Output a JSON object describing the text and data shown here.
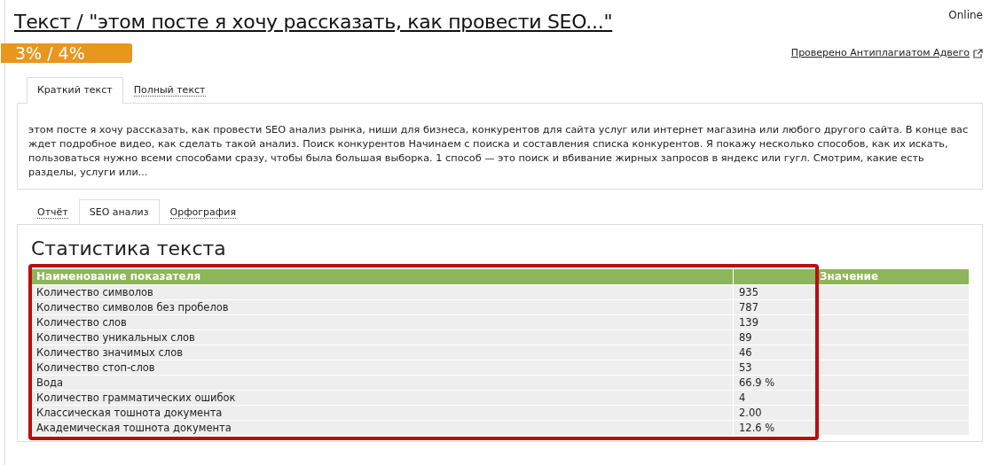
{
  "header": {
    "title": "Текст / \"этом посте я хочу рассказать, как провести SEO...\"",
    "status": "Online",
    "score": "3% / 4%",
    "check_link": "Проверено Антиплагиатом Адвего"
  },
  "text_tabs": [
    {
      "label": "Краткий текст",
      "selected": true
    },
    {
      "label": "Полный текст",
      "selected": false
    }
  ],
  "text_body": "этом посте я хочу рассказать, как провести SEO анализ рынка, ниши для бизнеса, конкурентов для сайта услуг или интернет магазина или любого другого сайта. В конце вас ждет подробное видео, как сделать такой анализ. Поиск конкурентов Начинаем с поиска и составления списка конкурентов. Я покажу несколько способов, как их искать, пользоваться нужно всеми способами сразу, чтобы была большая выборка. 1 способ — это поиск и вбивание жирных запросов в яндекс или гугл. Смотрим, какие есть разделы, услуги или...",
  "analysis_tabs": [
    {
      "label": "Отчёт",
      "selected": false
    },
    {
      "label": "SEO анализ",
      "selected": true
    },
    {
      "label": "Орфография",
      "selected": false
    }
  ],
  "stats": {
    "heading": "Статистика текста",
    "columns": [
      "Наименование показателя",
      "",
      "Значение"
    ],
    "highlighted": true,
    "rows": [
      [
        "Количество символов",
        "935"
      ],
      [
        "Количество символов без пробелов",
        "787"
      ],
      [
        "Количество слов",
        "139"
      ],
      [
        "Количество уникальных слов",
        "89"
      ],
      [
        "Количество значимых слов",
        "46"
      ],
      [
        "Количество стоп-слов",
        "53"
      ],
      [
        "Вода",
        "66.9 %"
      ],
      [
        "Количество грамматических ошибок",
        "4"
      ],
      [
        "Классическая тошнота документа",
        "2.00"
      ],
      [
        "Академическая тошнота документа",
        "12.6 %"
      ]
    ]
  }
}
